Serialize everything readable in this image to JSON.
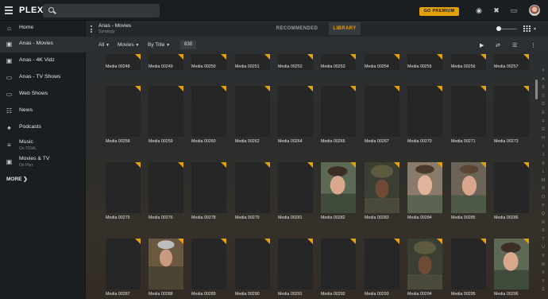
{
  "app": {
    "logo": "PLEX",
    "premium_label": "GO PREMIUM"
  },
  "sidebar": {
    "items": [
      {
        "label": "Home",
        "icon": "home-icon"
      },
      {
        "label": "Anas - Movies",
        "icon": "film-icon",
        "active": true
      },
      {
        "label": "Anas - 4K Vidz",
        "icon": "film-icon"
      },
      {
        "label": "Anas - TV Shows",
        "icon": "tv-icon"
      },
      {
        "label": "Web Shows",
        "icon": "tv-icon"
      },
      {
        "label": "News",
        "icon": "news-icon"
      },
      {
        "label": "Podcasts",
        "icon": "microphone-icon"
      },
      {
        "label": "Music",
        "sub": "On TIDAL",
        "icon": "music-list-icon"
      },
      {
        "label": "Movies & TV",
        "sub": "On Plex",
        "icon": "film-icon"
      }
    ],
    "more_label": "MORE"
  },
  "header": {
    "library_title": "Anas - Movies",
    "library_sub": "Synology",
    "tabs": [
      "RECOMMENDED",
      "LIBRARY"
    ],
    "active_tab": "LIBRARY"
  },
  "filters": {
    "all": "All",
    "type": "Movies",
    "sort": "By Title",
    "count": "838"
  },
  "alphabet": [
    "#",
    "A",
    "B",
    "C",
    "D",
    "E",
    "F",
    "G",
    "H",
    "I",
    "J",
    "K",
    "L",
    "M",
    "N",
    "O",
    "P",
    "Q",
    "R",
    "S",
    "T",
    "U",
    "V",
    "W",
    "X",
    "Y",
    "Z"
  ],
  "rows": [
    [
      "Media 00248",
      "Media 00249",
      "Media 00250",
      "Media 00251",
      "Media 00252",
      "Media 00253",
      "Media 00254",
      "Media 00255",
      "Media 00256",
      "Media 00257"
    ],
    [
      "Media 00258",
      "Media 00259",
      "Media 00260",
      "Media 00262",
      "Media 00264",
      "Media 00266",
      "Media 00267",
      "Media 00270",
      "Media 00271",
      "Media 00273"
    ],
    [
      "Media 00275",
      "Media 00276",
      "Media 00278",
      "Media 00279",
      "Media 00281",
      "Media 00282",
      "Media 00283",
      "Media 00284",
      "Media 00285",
      "Media 00286"
    ],
    [
      "Media 00287",
      "Media 00288",
      "Media 00289",
      "Media 00290",
      "Media 00291",
      "Media 00292",
      "Media 00293",
      "Media 00294",
      "Media 00295",
      "Media 00296"
    ]
  ],
  "thumbnails": {
    "2-5": "f1",
    "2-6": "f2",
    "2-7": "f3",
    "2-8": "f4",
    "3-1": "f5",
    "3-7": "f2",
    "3-9": "f1"
  },
  "accent_color": "#e5a00d"
}
